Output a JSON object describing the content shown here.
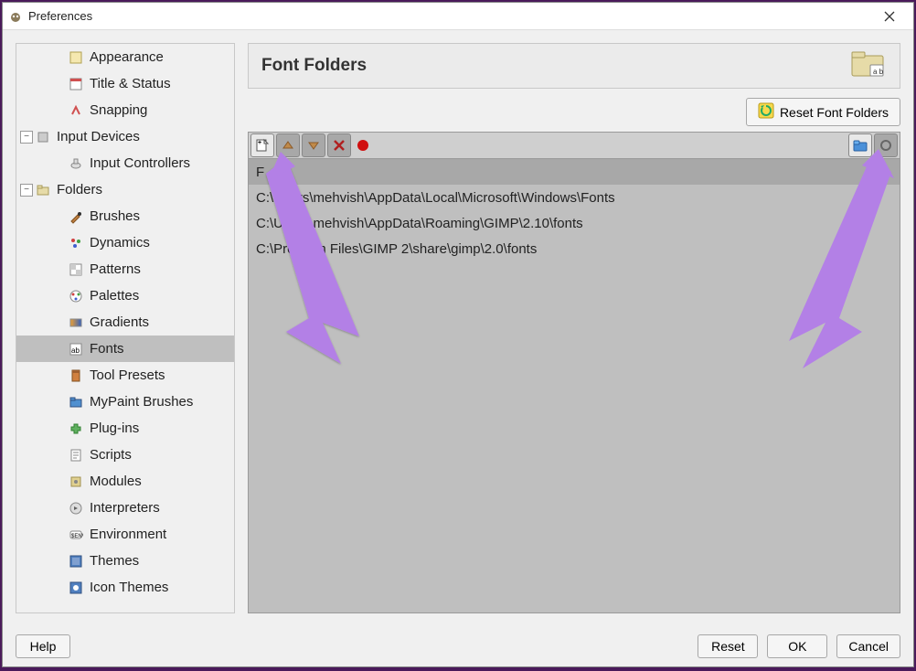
{
  "window": {
    "title": "Preferences"
  },
  "sidebar": {
    "items": [
      {
        "label": "Appearance",
        "indent": 2,
        "icon": "appearance"
      },
      {
        "label": "Title & Status",
        "indent": 2,
        "icon": "title"
      },
      {
        "label": "Snapping",
        "indent": 2,
        "icon": "snap"
      },
      {
        "label": "Input Devices",
        "indent": 0,
        "icon": "devices",
        "exp": true,
        "expLabel": "−"
      },
      {
        "label": "Input Controllers",
        "indent": 2,
        "icon": "controllers"
      },
      {
        "label": "Folders",
        "indent": 0,
        "icon": "folder",
        "exp": true,
        "expLabel": "−"
      },
      {
        "label": "Brushes",
        "indent": 2,
        "icon": "brush"
      },
      {
        "label": "Dynamics",
        "indent": 2,
        "icon": "dynamics"
      },
      {
        "label": "Patterns",
        "indent": 2,
        "icon": "patterns"
      },
      {
        "label": "Palettes",
        "indent": 2,
        "icon": "palettes"
      },
      {
        "label": "Gradients",
        "indent": 2,
        "icon": "gradients"
      },
      {
        "label": "Fonts",
        "indent": 2,
        "icon": "fonts",
        "selected": true
      },
      {
        "label": "Tool Presets",
        "indent": 2,
        "icon": "presets"
      },
      {
        "label": "MyPaint Brushes",
        "indent": 2,
        "icon": "mypaint"
      },
      {
        "label": "Plug-ins",
        "indent": 2,
        "icon": "plugins"
      },
      {
        "label": "Scripts",
        "indent": 2,
        "icon": "scripts"
      },
      {
        "label": "Modules",
        "indent": 2,
        "icon": "modules"
      },
      {
        "label": "Interpreters",
        "indent": 2,
        "icon": "interpreters"
      },
      {
        "label": "Environment",
        "indent": 2,
        "icon": "env"
      },
      {
        "label": "Themes",
        "indent": 2,
        "icon": "themes"
      },
      {
        "label": "Icon Themes",
        "indent": 2,
        "icon": "iconthemes"
      }
    ]
  },
  "main": {
    "title": "Font Folders",
    "reset_label": "Reset Font Folders",
    "path_input_value": "",
    "folders": [
      "F",
      "C:\\Users\\mehvish\\AppData\\Local\\Microsoft\\Windows\\Fonts",
      "C:\\Users\\mehvish\\AppData\\Roaming\\GIMP\\2.10\\fonts",
      "C:\\Program Files\\GIMP 2\\share\\gimp\\2.0\\fonts"
    ]
  },
  "footer": {
    "help": "Help",
    "reset": "Reset",
    "ok": "OK",
    "cancel": "Cancel"
  }
}
